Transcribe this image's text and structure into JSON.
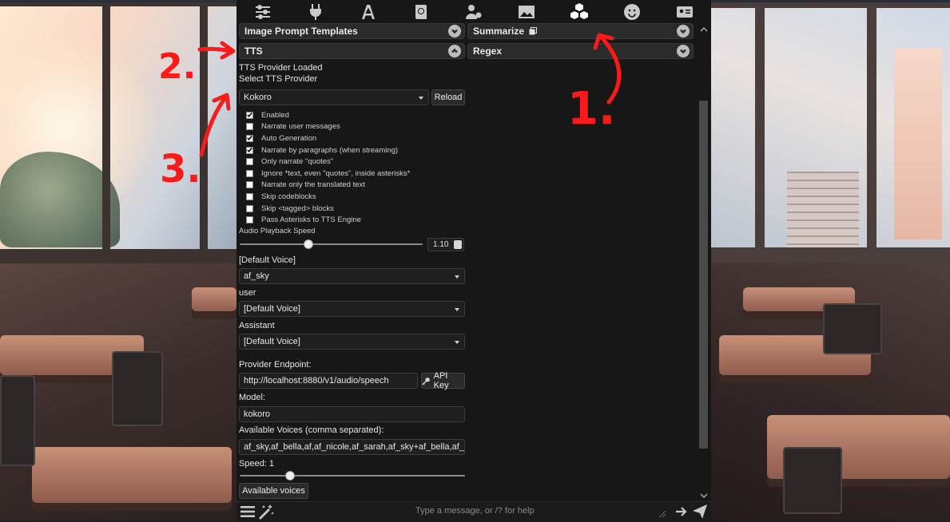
{
  "top_tabs": [
    {
      "icon": "sliders-icon",
      "active": false
    },
    {
      "icon": "plug-icon",
      "active": false
    },
    {
      "icon": "font-icon",
      "active": false
    },
    {
      "icon": "book-icon",
      "active": false
    },
    {
      "icon": "user-gear-icon",
      "active": false
    },
    {
      "icon": "image-icon",
      "active": false
    },
    {
      "icon": "cubes-icon",
      "active": true
    },
    {
      "icon": "smile-icon",
      "active": false
    },
    {
      "icon": "id-card-icon",
      "active": false
    }
  ],
  "drawers": {
    "image_prompt_templates": "Image Prompt Templates",
    "summarize": "Summarize",
    "tts": "TTS",
    "regex": "Regex"
  },
  "tts": {
    "status": "TTS Provider Loaded",
    "select_label": "Select TTS Provider",
    "provider": "Kokoro",
    "reload_button": "Reload",
    "options": [
      {
        "label": "Enabled",
        "checked": true
      },
      {
        "label": "Narrate user messages",
        "checked": false
      },
      {
        "label": "Auto Generation",
        "checked": true
      },
      {
        "label": "Narrate by paragraphs (when streaming)",
        "checked": true
      },
      {
        "label": "Only narrate \"quotes\"",
        "checked": false
      },
      {
        "label": "Ignore *text, even \"quotes\", inside asterisks*",
        "checked": false
      },
      {
        "label": "Narrate only the translated text",
        "checked": false
      },
      {
        "label": "Skip codeblocks",
        "checked": false
      },
      {
        "label": "Skip <tagged> blocks",
        "checked": false
      },
      {
        "label": "Pass Asterisks to TTS Engine",
        "checked": false
      }
    ],
    "playback_speed_label": "Audio Playback Speed",
    "playback_speed_value": "1.10",
    "playback_speed_fraction": 0.37,
    "voice_map": [
      {
        "label": "[Default Voice]",
        "value": "af_sky"
      },
      {
        "label": "user",
        "value": "[Default Voice]"
      },
      {
        "label": "Assistant",
        "value": "[Default Voice]"
      }
    ],
    "endpoint_label": "Provider Endpoint:",
    "endpoint_value": "http://localhost:8880/v1/audio/speech",
    "api_key_button": "API Key",
    "model_label": "Model:",
    "model_value": "kokoro",
    "voices_label": "Available Voices (comma separated):",
    "voices_value": "af_sky,af_bella,af,af_nicole,af_sarah,af_sky+af_bella,af_sk",
    "speed_label": "Speed: 1",
    "speed_fraction": 0.21,
    "available_voices_button": "Available voices"
  },
  "chat": {
    "placeholder": "Type a message, or /? for help"
  },
  "annotations": [
    "1.",
    "2.",
    "3."
  ],
  "colors": {
    "panel_bg": "#171717",
    "drawer_header_bg": "#2b2b2b",
    "annotation_red": "#ff1a1a"
  }
}
